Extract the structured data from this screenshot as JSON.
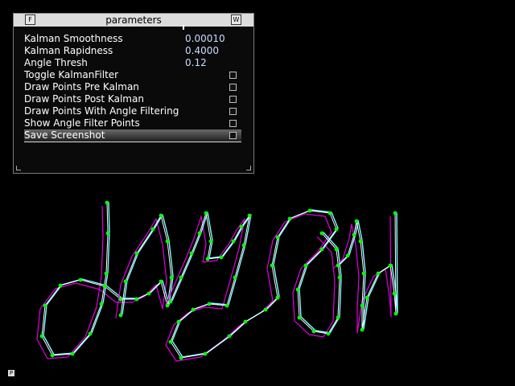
{
  "panel": {
    "title": "parameters",
    "collapse_glyph": "F",
    "minimize_glyph": "W",
    "sliders": [
      {
        "label": "Kalman Smoothness",
        "value": "0.00010"
      },
      {
        "label": "Kalman Rapidness",
        "value": "0.4000"
      },
      {
        "label": "Angle Thresh",
        "value": "0.12"
      }
    ],
    "toggles": [
      {
        "label": "Toggle KalmanFilter",
        "checked": false
      },
      {
        "label": "Draw Points Pre Kalman",
        "checked": false
      },
      {
        "label": "Draw Points Post Kalman",
        "checked": false
      },
      {
        "label": "Draw Points With Angle Filtering",
        "checked": false
      },
      {
        "label": "Show Angle Filter Points",
        "checked": false
      },
      {
        "label": "Save Screenshot",
        "checked": false,
        "highlighted": true
      }
    ]
  },
  "help_glyph": "P",
  "colors": {
    "raw_stroke": "#e000e0",
    "smooth_stroke": "#7fffff",
    "filtered_stroke": "#ffffff",
    "points": "#00ff00"
  }
}
